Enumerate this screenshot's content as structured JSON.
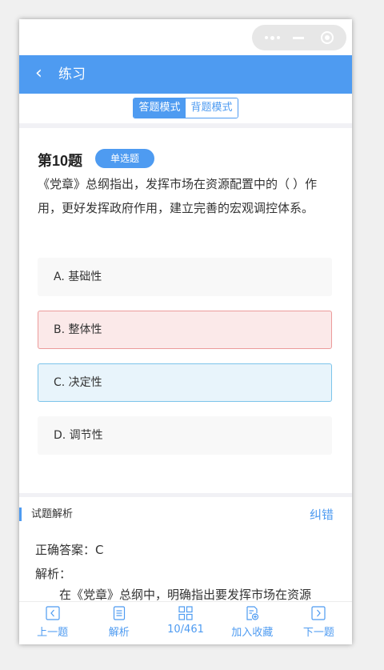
{
  "nav": {
    "back_icon": "chevron-left-icon",
    "title": "练习"
  },
  "mode": {
    "answer_mode": "答题模式",
    "recite_mode": "背题模式",
    "active": "answer_mode"
  },
  "question": {
    "number": "第10题",
    "type": "单选题",
    "text": "《党章》总纲指出，发挥市场在资源配置中的（ ）作用，更好发挥政府作用，建立完善的宏观调控体系。",
    "options": [
      {
        "label": "A. 基础性",
        "state": "normal"
      },
      {
        "label": "B. 整体性",
        "state": "wrong"
      },
      {
        "label": "C. 决定性",
        "state": "correct"
      },
      {
        "label": "D. 调节性",
        "state": "normal"
      }
    ]
  },
  "analysis": {
    "title": "试题解析",
    "report": "纠错",
    "correct_answer": "正确答案：C",
    "label": "解析：",
    "text": "在《党章》总纲中，明确指出要发挥市场在资源"
  },
  "bottom": {
    "prev": "上一题",
    "explain": "解析",
    "progress": "10/461",
    "favorite": "加入收藏",
    "next": "下一题"
  },
  "colors": {
    "accent": "#4e9bf1",
    "wrong_bg": "#fbe9e9",
    "wrong_border": "#ec9b9b",
    "correct_bg": "#e8f4fb",
    "correct_border": "#7cc4ea"
  }
}
